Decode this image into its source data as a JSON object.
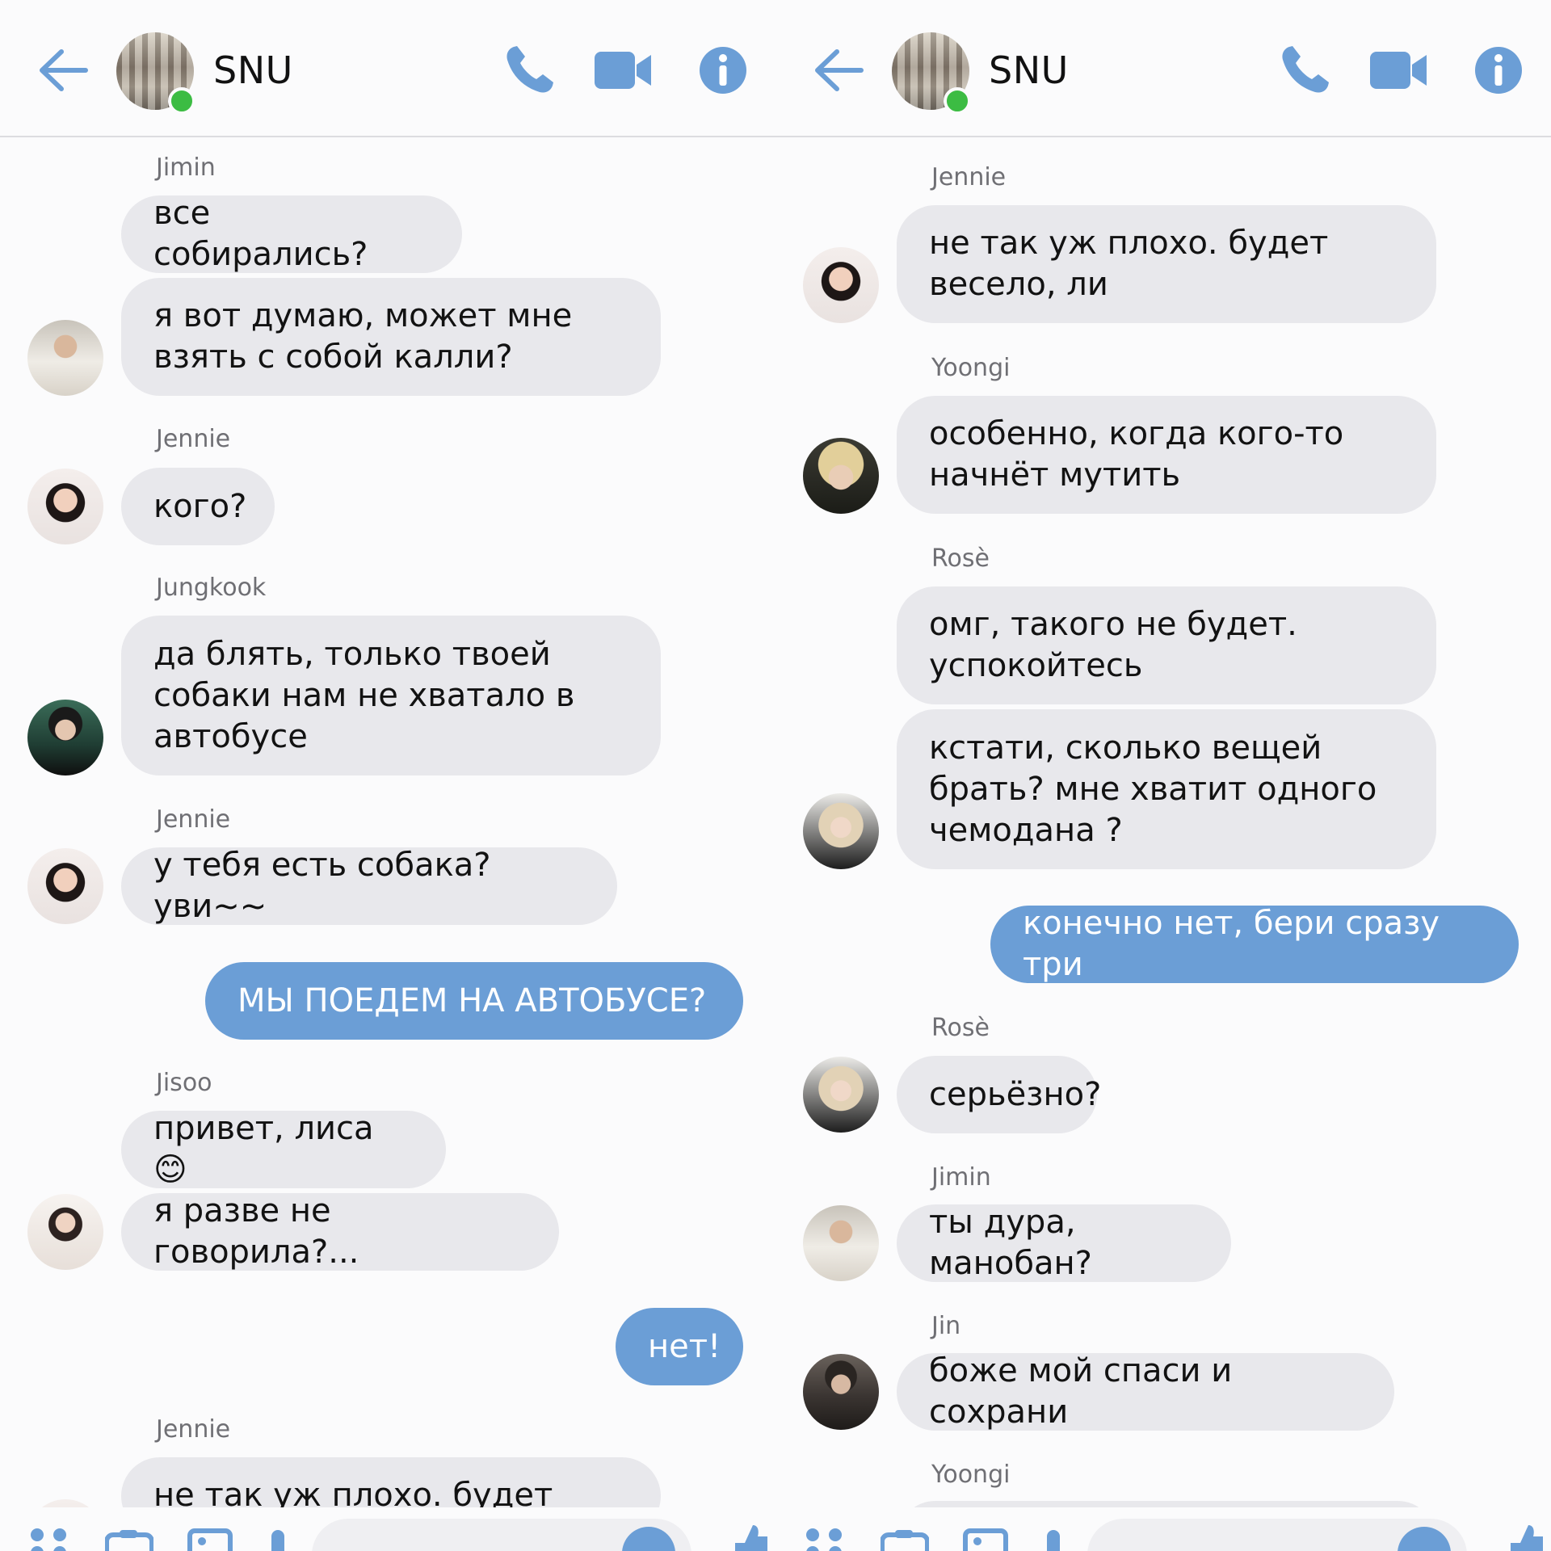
{
  "colors": {
    "accent": "#6b9ed6",
    "bubble_in": "#e8e8ec",
    "online": "#3cbc43"
  },
  "left": {
    "header": {
      "title": "SNU"
    },
    "messages": [
      {
        "sender": "Jimin",
        "text": "все собирались?"
      },
      {
        "text": "я вот думаю, может мне\nвзять с собой калли?"
      },
      {
        "sender": "Jennie",
        "text": "кого?"
      },
      {
        "sender": "Jungkook",
        "text": "да блять, только твоей\nсобаки нам не хватало в\nавтобусе"
      },
      {
        "sender": "Jennie",
        "text": "у тебя есть собака? уви~~"
      },
      {
        "outgoing": true,
        "text": "МЫ ПОЕДЕМ НА АВТОБУСЕ?"
      },
      {
        "sender": "Jisoo",
        "text": "привет, лиса 😊"
      },
      {
        "text": "я разве не говорила?..."
      },
      {
        "outgoing": true,
        "text": "нет!"
      },
      {
        "sender": "Jennie",
        "text": "не так уж плохо. будет"
      }
    ]
  },
  "right": {
    "header": {
      "title": "SNU"
    },
    "messages": [
      {
        "sender": "Jennie",
        "text": "не так уж плохо. будет\nвесело, ли"
      },
      {
        "sender": "Yoongi",
        "text": "особенно, когда кого-то\nначнёт мутить"
      },
      {
        "sender": "Rosè",
        "text": "омг, такого не будет.\nуспокойтесь"
      },
      {
        "text": "кстати, сколько вещей\nбрать? мне хватит одного\nчемодана ?"
      },
      {
        "outgoing": true,
        "text": "конечно нет, бери сразу три"
      },
      {
        "sender": "Rosè",
        "text": "серьёзно?"
      },
      {
        "sender": "Jimin",
        "text": "ты дура, манобан?"
      },
      {
        "sender": "Jin",
        "text": "боже мой спаси и сохрани"
      },
      {
        "sender": "Yoongi",
        "text": ""
      }
    ]
  },
  "icons": {
    "back": "arrow-left-icon",
    "call": "phone-icon",
    "video": "video-camera-icon",
    "info": "info-icon"
  }
}
